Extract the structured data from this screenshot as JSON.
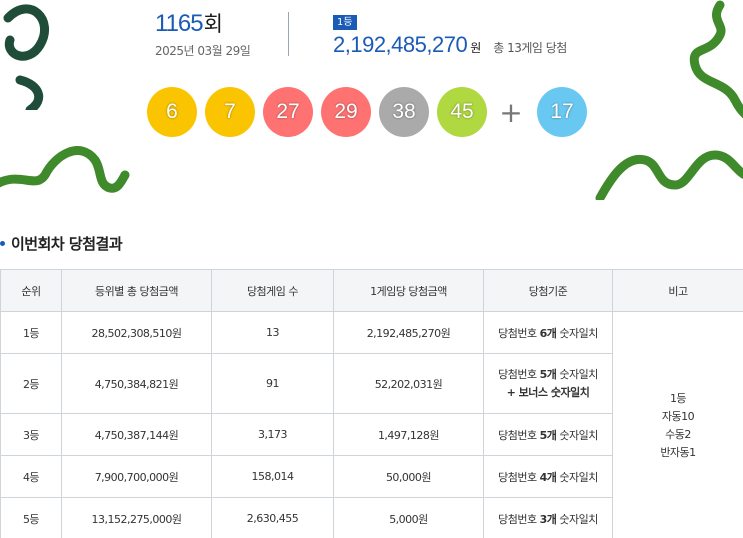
{
  "draw": {
    "round_number": "1165",
    "round_suffix": "회",
    "date": "2025년 03월 29일"
  },
  "first_prize": {
    "badge": "1등",
    "amount": "2,192,485,270",
    "unit": "원",
    "winners_text": "총 13게임 당첨"
  },
  "numbers": [
    {
      "value": "6",
      "color": "#fbc400"
    },
    {
      "value": "7",
      "color": "#fbc400"
    },
    {
      "value": "27",
      "color": "#ff7272"
    },
    {
      "value": "29",
      "color": "#ff7272"
    },
    {
      "value": "38",
      "color": "#aaaaaa"
    },
    {
      "value": "45",
      "color": "#b0d840"
    }
  ],
  "plus_symbol": "+",
  "bonus": {
    "value": "17",
    "color": "#69c8f2"
  },
  "section": {
    "title": "이번회차 당첨결과"
  },
  "table": {
    "headers": [
      "순위",
      "등위별 총 당첨금액",
      "당첨게임 수",
      "1게임당 당첨금액",
      "당첨기준",
      "비고"
    ],
    "rows": [
      {
        "rank": "1등",
        "total": "28,502,308,510원",
        "games": "13",
        "per_game": "2,192,485,270원",
        "criteria_pre": "당첨번호 ",
        "criteria_bold": "6개",
        "criteria_post": " 숫자일치",
        "criteria_line2": ""
      },
      {
        "rank": "2등",
        "total": "4,750,384,821원",
        "games": "91",
        "per_game": "52,202,031원",
        "criteria_pre": "당첨번호 ",
        "criteria_bold": "5개",
        "criteria_post": " 숫자일치",
        "criteria_line2": "+ 보너스 숫자일치"
      },
      {
        "rank": "3등",
        "total": "4,750,387,144원",
        "games": "3,173",
        "per_game": "1,497,128원",
        "criteria_pre": "당첨번호 ",
        "criteria_bold": "5개",
        "criteria_post": " 숫자일치",
        "criteria_line2": ""
      },
      {
        "rank": "4등",
        "total": "7,900,700,000원",
        "games": "158,014",
        "per_game": "50,000원",
        "criteria_pre": "당첨번호 ",
        "criteria_bold": "4개",
        "criteria_post": " 숫자일치",
        "criteria_line2": ""
      },
      {
        "rank": "5등",
        "total": "13,152,275,000원",
        "games": "2,630,455",
        "per_game": "5,000원",
        "criteria_pre": "당첨번호 ",
        "criteria_bold": "3개",
        "criteria_post": " 숫자일치",
        "criteria_line2": ""
      }
    ],
    "remark_lines": [
      "1등",
      "자동10",
      "수동2",
      "반자동1"
    ]
  }
}
